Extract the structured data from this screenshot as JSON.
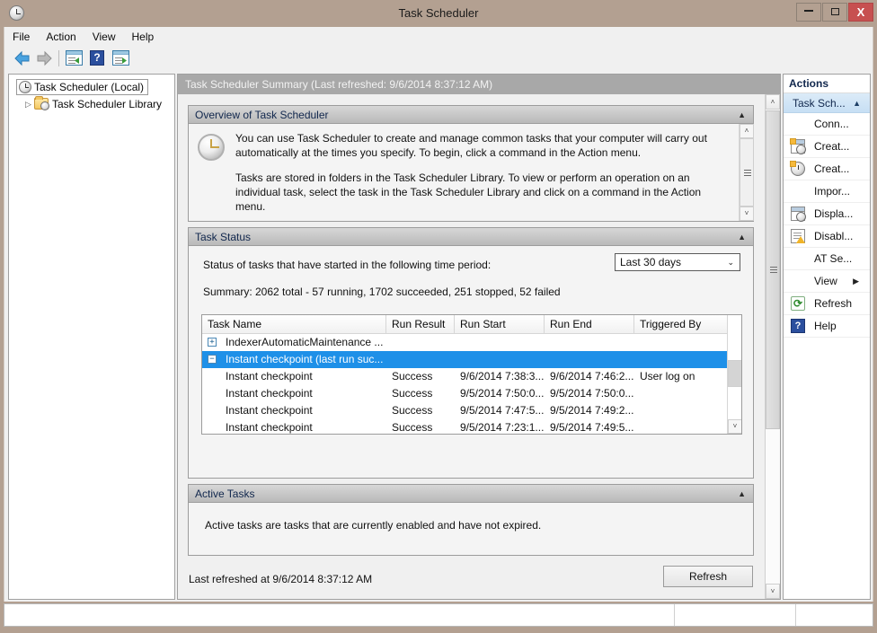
{
  "window": {
    "title": "Task Scheduler",
    "app_icon": "clock-icon",
    "minimize_label": "Minimize",
    "maximize_label": "Maximize",
    "close_label": "X"
  },
  "menubar": {
    "items": [
      {
        "label": "File"
      },
      {
        "label": "Action"
      },
      {
        "label": "View"
      },
      {
        "label": "Help"
      }
    ]
  },
  "toolbar": {
    "items": [
      {
        "name": "back-button",
        "icon": "back-arrow-icon"
      },
      {
        "name": "forward-button",
        "icon": "forward-arrow-icon"
      },
      {
        "name": "show-hide-console-tree-button",
        "icon": "window-tree-icon"
      },
      {
        "name": "help-button",
        "icon": "question-mark-icon"
      },
      {
        "name": "show-hide-action-pane-button",
        "icon": "window-pane-icon"
      }
    ]
  },
  "tree": {
    "root": {
      "label": "Task Scheduler (Local)",
      "icon": "clock-icon",
      "selected": true
    },
    "child": {
      "label": "Task Scheduler Library",
      "icon": "folder-clock-icon",
      "expander": "▷"
    }
  },
  "main": {
    "header": "Task Scheduler Summary (Last refreshed: 9/6/2014 8:37:12 AM)",
    "overview": {
      "title": "Overview of Task Scheduler",
      "collapse_chevron": "▲",
      "paragraphs": [
        "You can use Task Scheduler to create and manage common tasks that your computer will carry out automatically at the times you specify. To begin, click a command in the Action menu.",
        "Tasks are stored in folders in the Task Scheduler Library. To view or perform an operation on an individual task, select the task in the Task Scheduler Library and click on a command in the Action menu."
      ]
    },
    "task_status": {
      "title": "Task Status",
      "collapse_chevron": "▲",
      "period_label": "Status of tasks that have started in the following time period:",
      "period_selected": "Last 30 days",
      "period_chevron": "⌄",
      "summary": "Summary: 2062 total - 57 running, 1702 succeeded, 251 stopped, 52 failed",
      "columns": [
        "Task Name",
        "Run Result",
        "Run Start",
        "Run End",
        "Triggered By"
      ],
      "rows": [
        {
          "expander": "+",
          "task_name": "IndexerAutomaticMaintenance ...",
          "run_result": "",
          "run_start": "",
          "run_end": "",
          "triggered_by": "",
          "selected": false,
          "group": true
        },
        {
          "expander": "−",
          "task_name": "Instant checkpoint (last run suc...",
          "run_result": "",
          "run_start": "",
          "run_end": "",
          "triggered_by": "",
          "selected": true,
          "group": true
        },
        {
          "expander": "",
          "task_name": "Instant checkpoint",
          "run_result": "Success",
          "run_start": "9/6/2014 7:38:3...",
          "run_end": "9/6/2014 7:46:2...",
          "triggered_by": "User log on",
          "selected": false,
          "group": false
        },
        {
          "expander": "",
          "task_name": "Instant checkpoint",
          "run_result": "Success",
          "run_start": "9/5/2014 7:50:0...",
          "run_end": "9/5/2014 7:50:0...",
          "triggered_by": "",
          "selected": false,
          "group": false
        },
        {
          "expander": "",
          "task_name": "Instant checkpoint",
          "run_result": "Success",
          "run_start": "9/5/2014 7:47:5...",
          "run_end": "9/5/2014 7:49:2...",
          "triggered_by": "",
          "selected": false,
          "group": false
        },
        {
          "expander": "",
          "task_name": "Instant checkpoint",
          "run_result": "Success",
          "run_start": "9/5/2014 7:23:1...",
          "run_end": "9/5/2014 7:49:5...",
          "triggered_by": "",
          "selected": false,
          "group": false
        }
      ]
    },
    "active_tasks": {
      "title": "Active Tasks",
      "collapse_chevron": "▲",
      "description": "Active tasks are tasks that are currently enabled and have not expired."
    },
    "footer": {
      "last_refreshed": "Last refreshed at 9/6/2014 8:37:12 AM",
      "refresh_button": "Refresh"
    }
  },
  "actions": {
    "title": "Actions",
    "group_label": "Task Sch...",
    "group_chevron": "▲",
    "items": [
      {
        "label": "Conn...",
        "icon": "none"
      },
      {
        "label": "Creat...",
        "icon": "create-basic-task-icon"
      },
      {
        "label": "Creat...",
        "icon": "create-task-icon"
      },
      {
        "label": "Impor...",
        "icon": "none"
      },
      {
        "label": "Displa...",
        "icon": "display-all-tasks-icon"
      },
      {
        "label": "Disabl...",
        "icon": "disable-history-icon"
      },
      {
        "label": "AT Se...",
        "icon": "none"
      },
      {
        "label": "View",
        "icon": "none",
        "submenu": "▶"
      },
      {
        "label": "Refresh",
        "icon": "refresh-icon"
      },
      {
        "label": "Help",
        "icon": "help-icon"
      }
    ]
  },
  "statusbar": {
    "text": ""
  },
  "colors": {
    "frame": "#b3a091",
    "close_button": "#c75050",
    "selection": "#1e90e8",
    "actions_group": "#cde2f5",
    "header_gray": "#a8a8a8"
  }
}
